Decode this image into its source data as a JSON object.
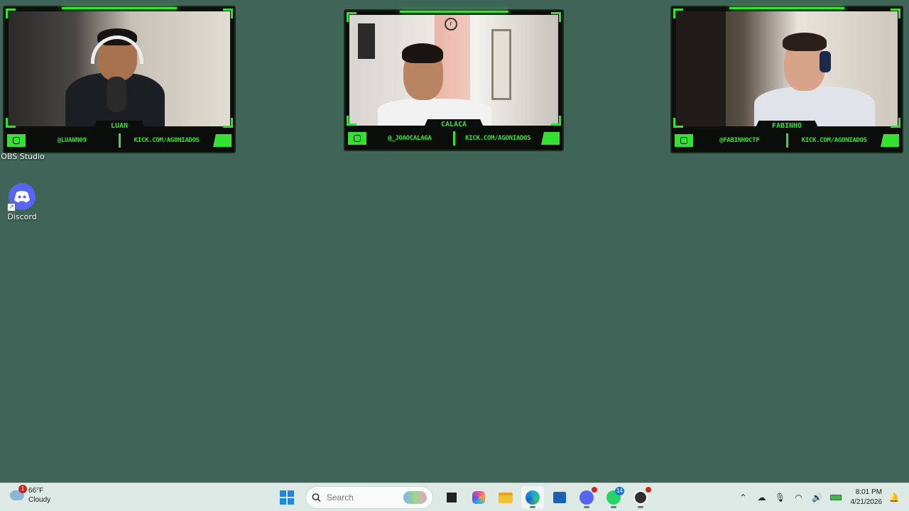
{
  "desktop": {
    "icons": [
      {
        "label": "OBS Studio"
      },
      {
        "label": "Discord"
      }
    ]
  },
  "cameras": [
    {
      "name": "LUAN",
      "handle": "@LUANN09",
      "site": "KICK.COM/AGONIADOS"
    },
    {
      "name": "CALAÇA",
      "handle": "@_JOAOCALAGA",
      "site": "KICK.COM/AGONIADOS"
    },
    {
      "name": "FABINHO",
      "handle": "@FABINHOCTF",
      "site": "KICK.COM/AGONIADOS"
    }
  ],
  "taskbar": {
    "weather": {
      "temp": "66°F",
      "condition": "Cloudy",
      "badge": "1"
    },
    "search": {
      "placeholder": "Search"
    },
    "badges": {
      "discord": "",
      "whatsapp": "14"
    },
    "clock": {
      "time": "8:01 PM",
      "date": "4/21/2026"
    }
  },
  "colors": {
    "desktop": "#3f6558",
    "accent": "#35e032",
    "taskbar": "#dde9e4"
  }
}
